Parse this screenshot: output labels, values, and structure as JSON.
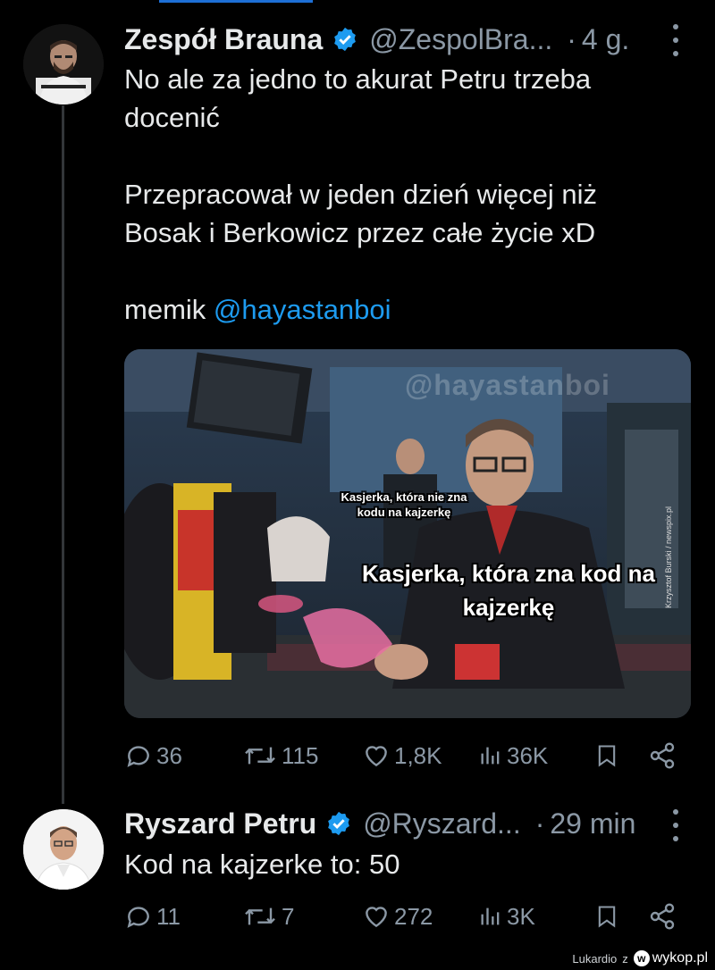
{
  "tweets": [
    {
      "name": "Zespół Brauna",
      "handle": "@ZespolBra...",
      "separator": "·",
      "time": "4 g.",
      "text_lines": [
        "No ale za jedno to akurat Petru trzeba",
        "docenić",
        "",
        "Przepracował w jeden dzień więcej niż",
        "Bosak i Berkowicz przez całe życie xD",
        ""
      ],
      "mention_prefix": "memik ",
      "mention": "@hayastanboi",
      "media": {
        "watermark": "@hayastanboi",
        "caption_small": "Kasjerka, która nie zna kodu na kajzerkę",
        "caption_big": "Kasjerka, która zna kod na kajzerkę",
        "credit": "Krzysztof Burski / newspix.pl"
      },
      "stats": {
        "replies": "36",
        "reposts": "115",
        "likes": "1,8K",
        "views": "36K"
      }
    },
    {
      "name": "Ryszard Petru",
      "handle": "@Ryszard...",
      "separator": "·",
      "time": "29 min",
      "text": "Kod na kajzerke to: 50",
      "stats": {
        "replies": "11",
        "reposts": "7",
        "likes": "272",
        "views": "3K"
      }
    }
  ],
  "footer": {
    "user": "Lukardio",
    "preposition": "z",
    "site": "wykop.pl",
    "logo_letter": "w"
  },
  "colors": {
    "background": "#000000",
    "text": "#e7e9ea",
    "muted": "#8b98a5",
    "link": "#1d9bf0",
    "verified": "#1d9bf0"
  },
  "icons": [
    "verified-badge-icon",
    "more-options-icon",
    "reply-icon",
    "repost-icon",
    "like-icon",
    "views-icon",
    "bookmark-icon",
    "share-icon"
  ]
}
